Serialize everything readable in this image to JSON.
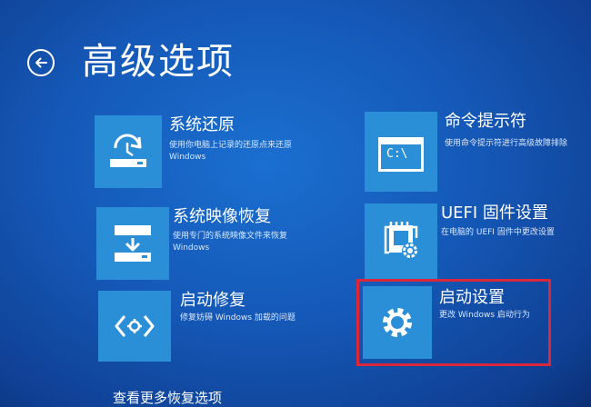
{
  "page": {
    "title": "高级选项",
    "back_icon": "back-arrow-icon"
  },
  "options": [
    {
      "title": "系统还原",
      "desc_line1": "使用你电脑上记录的还原点来还原",
      "desc_line2": "Windows",
      "icon": "system-restore-icon"
    },
    {
      "title": "系统映像恢复",
      "desc_line1": "使用专门的系统映像文件来恢复",
      "desc_line2": "Windows",
      "icon": "system-image-icon"
    },
    {
      "title": "启动修复",
      "desc_line1": "修复妨碍 Windows 加载的问题",
      "icon": "startup-repair-icon"
    },
    {
      "title": "命令提示符",
      "desc_line1": "使用命令提示符进行高级故障排除",
      "icon": "command-prompt-icon",
      "icon_text": "C:\\"
    },
    {
      "title": "UEFI 固件设置",
      "desc_line1": "在电脑的 UEFI 固件中更改设置",
      "icon": "uefi-settings-icon"
    },
    {
      "title": "启动设置",
      "desc_line1": "更改 Windows 启动行为",
      "icon": "gear-icon"
    }
  ],
  "more_link": "查看更多恢复选项",
  "colors": {
    "background": "#1559b8",
    "tile": "#2b8fd8",
    "highlight": "#d9283c"
  }
}
